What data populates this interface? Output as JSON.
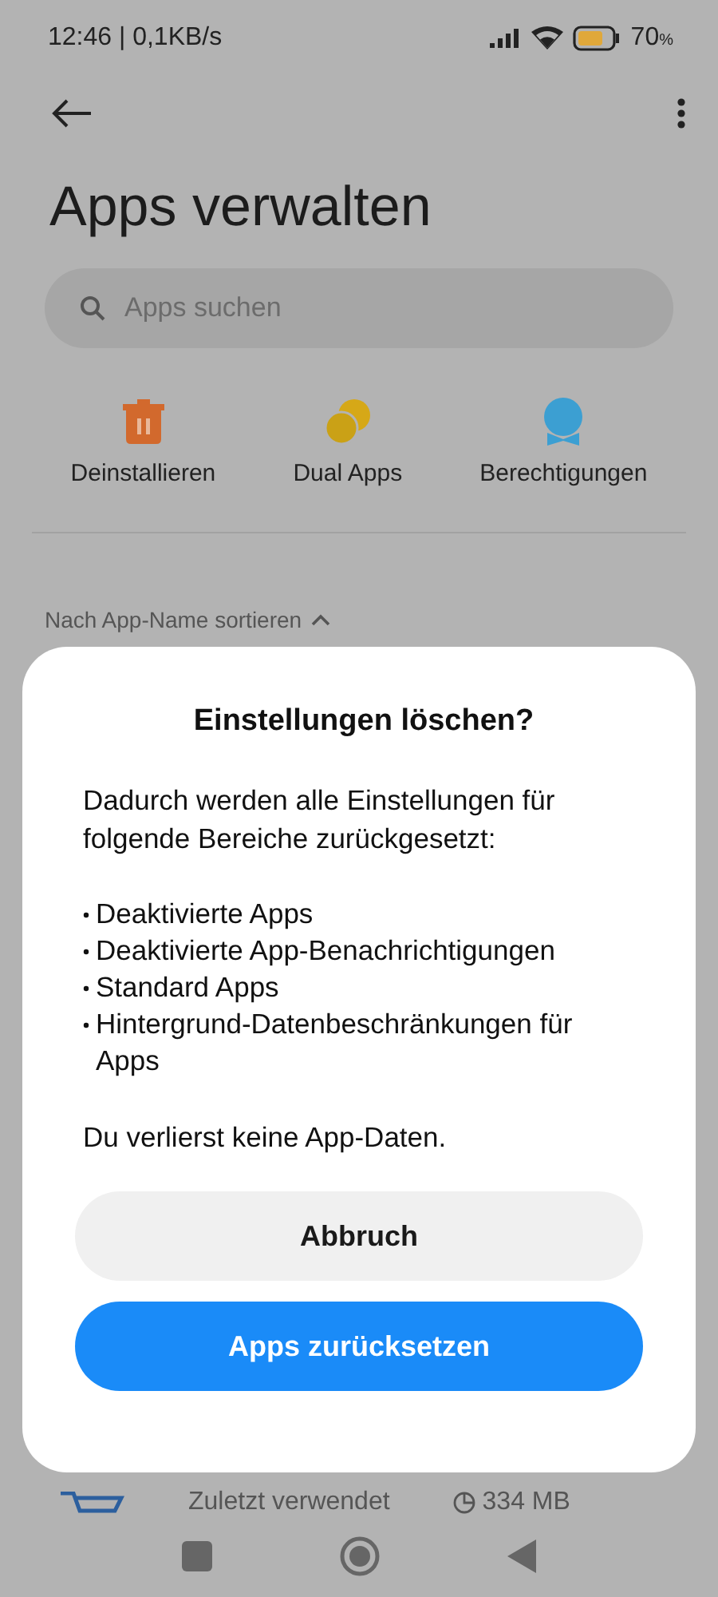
{
  "status_bar": {
    "time": "12:46 | 0,1KB/s",
    "battery": "70",
    "battery_unit": "%"
  },
  "header": {
    "title": "Apps verwalten"
  },
  "search": {
    "placeholder": "Apps suchen"
  },
  "shortcuts": [
    {
      "label": "Deinstallieren",
      "kind": "uninstall"
    },
    {
      "label": "Dual Apps",
      "kind": "dual"
    },
    {
      "label": "Berechtigungen",
      "kind": "permissions"
    }
  ],
  "sort": {
    "label": "Nach App-Name sortieren"
  },
  "app_row": {
    "usage": "Zuletzt verwendet",
    "size": "334 MB"
  },
  "dialog": {
    "title": "Einstellungen löschen?",
    "message": "Dadurch werden alle Einstellungen für folgende Bereiche zurückgesetzt:",
    "items": [
      "Deaktivierte Apps",
      "Deaktivierte App-Benachrichtigungen",
      "Standard Apps",
      "Hintergrund-Datenbeschränkungen für Apps"
    ],
    "footer": "Du verlierst keine App-Daten.",
    "buttons": [
      {
        "label": "Abbruch",
        "kind": "secondary"
      },
      {
        "label": "Apps zurücksetzen",
        "kind": "primary"
      }
    ]
  }
}
